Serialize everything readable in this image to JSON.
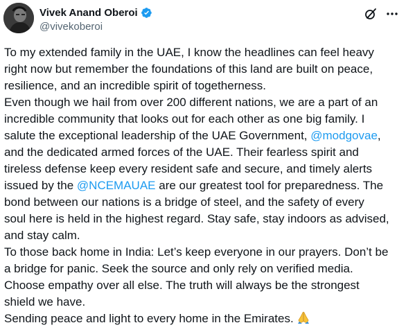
{
  "author": {
    "display_name": "Vivek Anand Oberoi",
    "handle": "@vivekoberoi",
    "verified": true,
    "avatar": "profile-photo"
  },
  "header_icons": {
    "grok": "grok-icon",
    "more": "more-icon"
  },
  "post": {
    "lines": [
      [
        "To my extended family in the UAE, I know the headlines can feel heavy"
      ],
      [
        "right now but remember the foundations of this land are built on peace,"
      ],
      [
        "resilience, and an incredible spirit of togetherness."
      ],
      [
        "Even though we hail from over 200 different nations, we are a part of an"
      ],
      [
        "incredible community that looks out for each other as one big family.  I"
      ],
      [
        "salute the exceptional leadership of the UAE Government, "
      ],
      [
        "and the dedicated armed forces of the UAE. Their fearless spirit and"
      ],
      [
        "tireless defense keep every resident safe and secure, and timely alerts"
      ],
      [
        "issued by the "
      ],
      [
        "bond between our nations is a bridge of steel, and the safety of every"
      ],
      [
        "soul here is held in the highest regard. Stay safe, stay indoors as advised,"
      ],
      [
        "and stay calm."
      ],
      [
        "To those back home in India: Let’s keep everyone in our prayers. Don’t be"
      ],
      [
        "a bridge for panic. Seek the source and only rely on verified media."
      ],
      [
        "Choose empathy over all else. The truth will always be the strongest"
      ],
      [
        "shield we have."
      ],
      [
        "Sending peace and light to every home in the Emirates."
      ]
    ],
    "mention_1": "@modgovae",
    "mention_1_after": ",",
    "mention_2": "@NCEMAUAE",
    "mention_2_after": " are our greatest tool for preparedness. The",
    "emoji": "folded-hands-emoji"
  },
  "colors": {
    "text": "#0f1419",
    "secondary": "#536471",
    "link": "#1d9bf0",
    "verified": "#1d9bf0"
  }
}
